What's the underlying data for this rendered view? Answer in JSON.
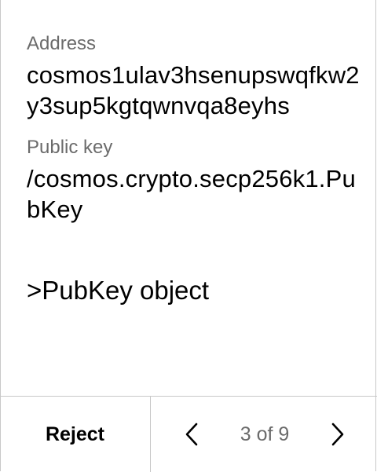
{
  "address": {
    "label": "Address",
    "value": "cosmos1ulav3hsenupswqfkw2y3sup5kgtqwnvqa8eyhs"
  },
  "public_key": {
    "label": "Public key",
    "value": "/cosmos.crypto.secp256k1.PubKey"
  },
  "object_link": ">PubKey object",
  "footer": {
    "reject_label": "Reject",
    "page_indicator": "3 of 9",
    "prev_icon": "chevron-left-icon",
    "next_icon": "chevron-right-icon"
  },
  "colors": {
    "label": "#6b6b6b",
    "text": "#000000",
    "divider": "#c8c8c8"
  }
}
